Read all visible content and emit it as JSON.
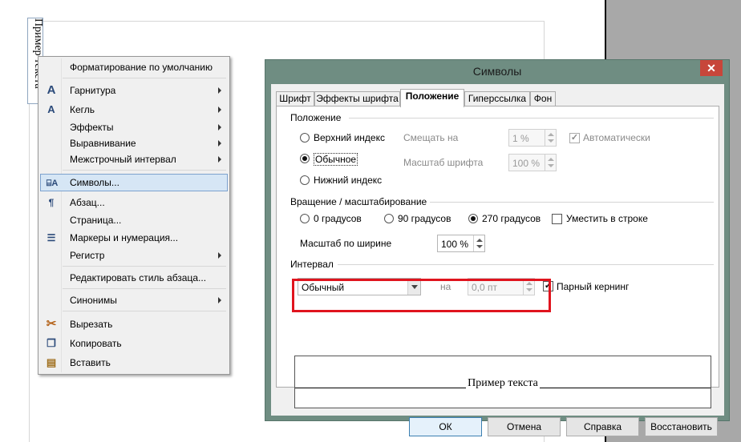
{
  "document": {
    "sample_text": "Пример текста"
  },
  "context_menu": {
    "items": [
      {
        "label": "Форматирование по умолчанию",
        "icon": "",
        "submenu": false
      },
      {
        "label": "Гарнитура",
        "icon": "font-icon",
        "submenu": true
      },
      {
        "label": "Кегль",
        "icon": "font-size-icon",
        "submenu": true
      },
      {
        "label": "Эффекты",
        "icon": "",
        "submenu": true
      },
      {
        "label": "Выравнивание",
        "icon": "",
        "submenu": true
      },
      {
        "label": "Межстрочный интервал",
        "icon": "",
        "submenu": true
      },
      {
        "label": "Символы...",
        "icon": "characters-icon",
        "submenu": false,
        "highlighted": true
      },
      {
        "label": "Абзац...",
        "icon": "paragraph-icon",
        "submenu": false
      },
      {
        "label": "Страница...",
        "icon": "",
        "submenu": false
      },
      {
        "label": "Маркеры и нумерация...",
        "icon": "bullets-icon",
        "submenu": false
      },
      {
        "label": "Регистр",
        "icon": "",
        "submenu": true
      },
      {
        "label": "Редактировать стиль абзаца...",
        "icon": "",
        "submenu": false
      },
      {
        "label": "Синонимы",
        "icon": "",
        "submenu": true
      },
      {
        "label": "Вырезать",
        "icon": "scissors-icon",
        "submenu": false
      },
      {
        "label": "Копировать",
        "icon": "copy-icon",
        "submenu": false
      },
      {
        "label": "Вставить",
        "icon": "paste-icon",
        "submenu": false
      }
    ]
  },
  "dialog": {
    "title": "Символы",
    "close_glyph": "✕",
    "tabs": [
      "Шрифт",
      "Эффекты шрифта",
      "Положение",
      "Гиперссылка",
      "Фон"
    ],
    "active_tab": "Положение",
    "position": {
      "section_title": "Положение",
      "superscript": "Верхний индекс",
      "normal": "Обычное",
      "subscript": "Нижний индекс",
      "selected": "normal",
      "raise_lower_label": "Смещать на",
      "raise_lower_value": "1 %",
      "auto_label": "Автоматически",
      "auto_checked": true,
      "rel_size_label": "Масштаб шрифта",
      "rel_size_value": "100 %"
    },
    "rotation": {
      "section_title": "Вращение / масштабирование",
      "deg0": "0 градусов",
      "deg90": "90 градусов",
      "deg270": "270 градусов",
      "selected": "270",
      "fit_to_line_label": "Уместить в строке",
      "fit_to_line_checked": false,
      "scale_width_label": "Масштаб по ширине",
      "scale_width_value": "100 %"
    },
    "spacing": {
      "section_title": "Интервал",
      "mode_value": "Обычный",
      "by_label": "на",
      "by_value": "0,0 пт",
      "pair_kerning_label": "Парный кернинг",
      "pair_kerning_checked": true
    },
    "preview_text": "Пример текста",
    "buttons": {
      "ok": "ОК",
      "cancel": "Отмена",
      "help": "Справка",
      "reset": "Восстановить"
    },
    "colors": {
      "title_bar": "#6f8d82",
      "highlight_box": "#e0141e",
      "close": "#c7463a"
    }
  }
}
